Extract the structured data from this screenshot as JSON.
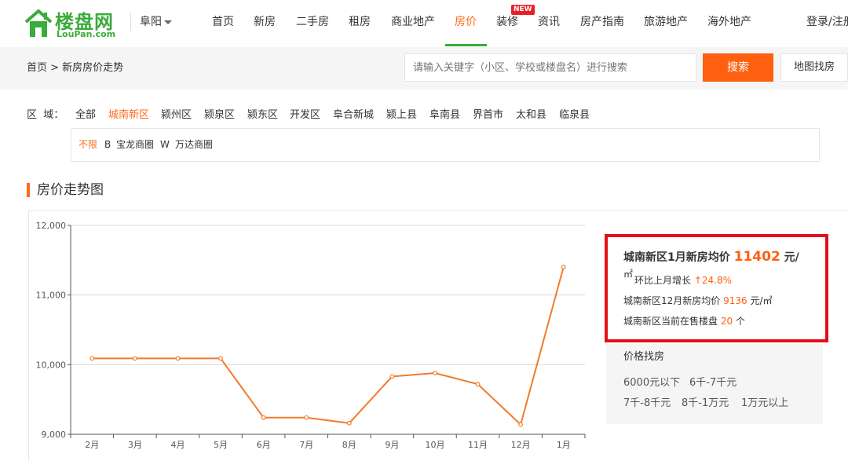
{
  "header": {
    "logo_cn": "楼盘网",
    "logo_en": "LouPan.com",
    "city": "阜阳",
    "nav": [
      "首页",
      "新房",
      "二手房",
      "租房",
      "商业地产",
      "房价",
      "装修",
      "资讯",
      "房产指南",
      "旅游地产",
      "海外地产"
    ],
    "active_nav": "房价",
    "new_badge": "NEW",
    "login": "登录/注册",
    "colors": {
      "brand_green": "#3bab3a",
      "accent_orange": "#ff6010"
    }
  },
  "subbar": {
    "breadcrumb": "首页 > 新房房价走势",
    "search_placeholder": "请输入关键字（小区、学校或楼盘名）进行搜索",
    "search_button": "搜索",
    "map_button": "地图找房"
  },
  "filter": {
    "label": "区  域：",
    "districts": [
      "全部",
      "城南新区",
      "颍州区",
      "颍泉区",
      "颍东区",
      "开发区",
      "阜合新城",
      "颍上县",
      "阜南县",
      "界首市",
      "太和县",
      "临泉县"
    ],
    "active_district": "城南新区",
    "sub_items": [
      "不限",
      "B",
      "宝龙商圈",
      "W",
      "万达商圈"
    ],
    "active_sub": "不限"
  },
  "section": {
    "title": "房价走势图"
  },
  "chart_data": {
    "type": "line",
    "title": "",
    "xlabel": "",
    "ylabel": "",
    "categories": [
      "2月",
      "3月",
      "4月",
      "5月",
      "6月",
      "7月",
      "8月",
      "9月",
      "10月",
      "11月",
      "12月",
      "1月"
    ],
    "series": [
      {
        "values": [
          10090,
          10090,
          10090,
          10090,
          9240,
          9240,
          9160,
          9830,
          9880,
          9720,
          9140,
          11402
        ],
        "color": "#f07b2b"
      }
    ],
    "y_ticks": [
      "12,000",
      "11,000",
      "10,000",
      "9,000"
    ],
    "ylim": [
      9000,
      12000
    ],
    "grid": true
  },
  "info": {
    "line1_prefix": "城南新区1月新房均价",
    "price": "11402",
    "unit": "元/",
    "sqm": "㎡",
    "mom_label": "环比上月增长",
    "mom_arrow": "↑",
    "mom_value": "24.8%",
    "line3_prefix": "城南新区12月新房均价",
    "prev_price": "9136",
    "prev_unit": "元/㎡",
    "line4_prefix": "城南新区当前在售楼盘",
    "count": "20",
    "count_unit": "个"
  },
  "price_search": {
    "title": "价格找房",
    "links": [
      "6000元以下",
      "6千-7千元",
      "7千-8千元",
      "8千-1万元",
      "1万元以上"
    ]
  }
}
